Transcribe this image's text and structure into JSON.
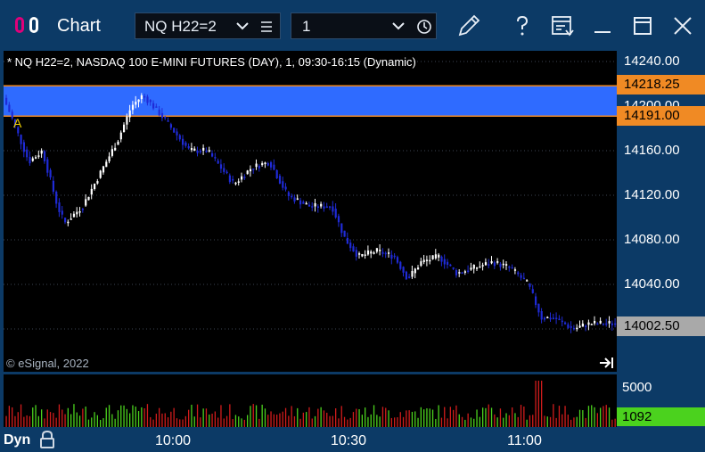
{
  "window": {
    "title": "Chart",
    "symbol": "NQ H22=2",
    "interval": "1"
  },
  "chart": {
    "header": "* NQ H22=2, NASDAQ 100 E-MINI FUTURES (DAY), 1, 09:30-16:15 (Dynamic)",
    "copyright": "© eSignal, 2022",
    "marker_label": "A",
    "price_axis": [
      "14240.00",
      "14200.00",
      "14160.00",
      "14120.00",
      "14080.00",
      "14040.00"
    ],
    "band_top_price": "14218.25",
    "band_bottom_price": "14191.00",
    "last_price": "14002.50",
    "volume_axis_label": "5000",
    "last_volume": "1092",
    "time_axis": [
      "10:00",
      "10:30",
      "11:00"
    ],
    "mode_label": "Dyn"
  },
  "colors": {
    "background": "#0c3a66",
    "plot_bg": "#000000",
    "up_candle": "#ffffff",
    "down_candle": "#1f2bd6",
    "band_fill": "#2f6bff",
    "band_line": "#f08a24",
    "last_price_tag": "#a9a9a9",
    "volume_up": "#4bd21e",
    "volume_down": "#d01c1c"
  },
  "icons": [
    "logo-icon",
    "chevron-down-icon",
    "menu-lines-icon",
    "clock-icon",
    "pencil-icon",
    "help-icon",
    "template-icon",
    "minimize-icon",
    "maximize-icon",
    "close-icon",
    "scroll-to-end-icon",
    "lock-icon"
  ]
}
